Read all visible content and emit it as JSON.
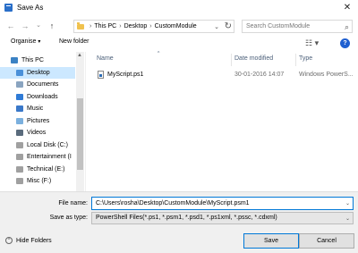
{
  "window": {
    "title": "Save As",
    "close_glyph": "✕",
    "icon": "save-as-app-icon"
  },
  "nav": {
    "back": "←",
    "forward": "→",
    "dropdown": "⌄",
    "up": "↑",
    "breadcrumb": [
      "This PC",
      "Desktop",
      "CustomModule"
    ],
    "breadcrumb_sep": "›",
    "address_dropdown": "⌄",
    "refresh": "↻",
    "search_placeholder": "Search CustomModule",
    "search_icon": "⌕"
  },
  "command_bar": {
    "organise": "Organise",
    "organise_arrow": "▾",
    "new_folder": "New folder",
    "view_glyph": "☷ ▾",
    "help": "?"
  },
  "sidebar": {
    "items": [
      {
        "label": "This PC",
        "icon": "computer-icon",
        "color": "#3b82c4"
      },
      {
        "label": "Desktop",
        "icon": "desktop-icon",
        "color": "#4a90d9",
        "selected": true
      },
      {
        "label": "Documents",
        "icon": "documents-icon",
        "color": "#8aa4c0"
      },
      {
        "label": "Downloads",
        "icon": "downloads-icon",
        "color": "#2f7bd6"
      },
      {
        "label": "Music",
        "icon": "music-icon",
        "color": "#3a78c9"
      },
      {
        "label": "Pictures",
        "icon": "pictures-icon",
        "color": "#7bb0de"
      },
      {
        "label": "Videos",
        "icon": "videos-icon",
        "color": "#5a6b7c"
      },
      {
        "label": "Local Disk (C:)",
        "icon": "drive-icon",
        "color": "#a0a0a0"
      },
      {
        "label": "Entertainment (I",
        "icon": "drive-icon",
        "color": "#a0a0a0"
      },
      {
        "label": "Technical (E:)",
        "icon": "drive-icon",
        "color": "#a0a0a0"
      },
      {
        "label": "Misc (F:)",
        "icon": "drive-icon",
        "color": "#a0a0a0"
      }
    ]
  },
  "columns": {
    "name": "Name",
    "date_modified": "Date modified",
    "type": "Type",
    "sort_glyph": "^"
  },
  "files": [
    {
      "name": "MyScript.ps1",
      "date_modified": "30-01-2016 14:07",
      "type": "Windows PowerS..."
    }
  ],
  "form": {
    "file_name_label": "File name:",
    "file_name_value": "C:\\Users\\rosha\\Desktop\\CustomModule\\MyScript.psm1",
    "save_type_label": "Save as type:",
    "save_type_value": "PowerShell Files(*.ps1, *.psm1, *.psd1, *.ps1xml, *.pssc, *.cdxml)",
    "dropdown_glyph": "⌄"
  },
  "footer": {
    "hide_folders": "Hide Folders",
    "hide_glyph": "^",
    "save": "Save",
    "cancel": "Cancel"
  },
  "colors": {
    "accent": "#0078d7",
    "selection": "#cce8ff"
  }
}
